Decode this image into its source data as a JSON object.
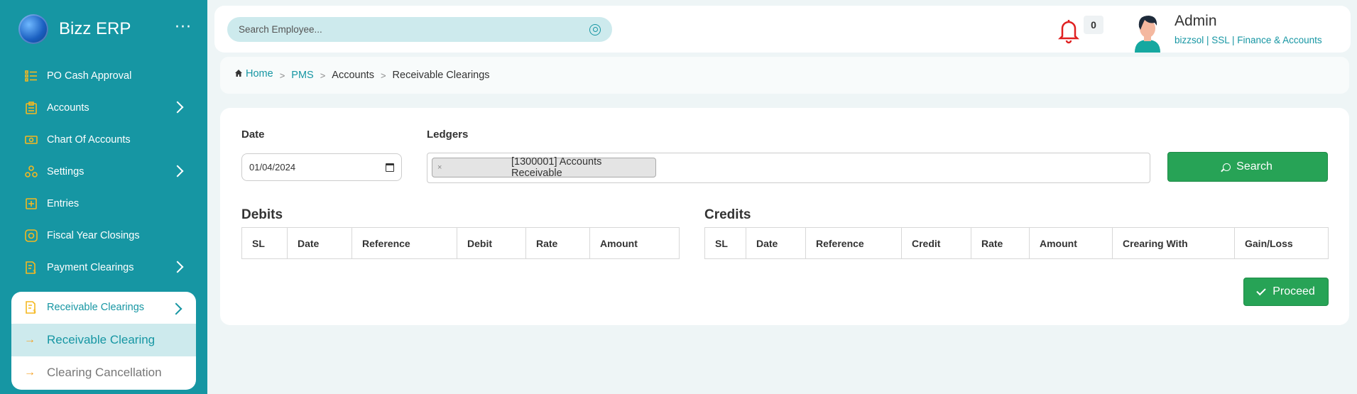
{
  "brand": {
    "name": "Bizz ERP",
    "menu_dots": "···"
  },
  "sidebar": {
    "items": [
      {
        "label": "PO Cash Approval"
      },
      {
        "label": "Accounts"
      },
      {
        "label": "Chart Of Accounts"
      },
      {
        "label": "Settings"
      },
      {
        "label": "Entries"
      },
      {
        "label": "Fiscal Year Closings"
      },
      {
        "label": "Payment Clearings"
      }
    ],
    "submenu": {
      "title": "Receivable Clearings",
      "items": [
        {
          "label": "Receivable Clearing",
          "active": true
        },
        {
          "label": "Clearing Cancellation",
          "active": false
        }
      ]
    }
  },
  "header": {
    "search_placeholder": "Search Employee...",
    "notification_count": "0",
    "user_name": "Admin",
    "user_sub": "bizzsol | SSL  | Finance & Accounts"
  },
  "breadcrumb": {
    "items": [
      "Home",
      "PMS",
      "Accounts",
      "Receivable Clearings"
    ]
  },
  "form": {
    "date_label": "Date",
    "date_value": "01/04/2024",
    "ledgers_label": "Ledgers",
    "ledger_chip": "[1300001] Accounts Receivable",
    "ledger_chip_remove": "×",
    "search_button": "Search"
  },
  "debits": {
    "title": "Debits",
    "columns": [
      "SL",
      "Date",
      "Reference",
      "Debit",
      "Rate",
      "Amount"
    ]
  },
  "credits": {
    "title": "Credits",
    "columns": [
      "SL",
      "Date",
      "Reference",
      "Credit",
      "Rate",
      "Amount",
      "Crearing With",
      "Gain/Loss"
    ]
  },
  "proceed_button": "Proceed",
  "colors": {
    "accent": "#1696a3",
    "success": "#27a356",
    "icon": "#f5b820",
    "bell": "#e02020"
  }
}
